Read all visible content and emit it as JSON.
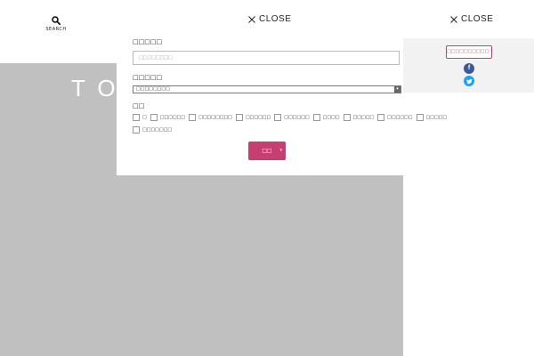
{
  "header": {
    "search_label": "SEARCH",
    "close_label_1": "CLOSE",
    "close_label_2": "CLOSE"
  },
  "hero": {
    "text": "TO"
  },
  "search_form": {
    "field1_label": "□□□□□",
    "field1_placeholder": "□□□□□□□□",
    "field2_label": "□□□□□",
    "field2_selected": "□□□□□□□□",
    "field3_label": "□□",
    "checkboxes": [
      "□",
      "□□□□□□",
      "□□□□□□□□",
      "□□□□□□",
      "□□□□□□",
      "□□□□",
      "□□□□□",
      "□□□□□□",
      "□□□□□",
      "□□□□□□□"
    ],
    "submit_label": "□□"
  },
  "share": {
    "button_label": "□□□□□□□□□□ *",
    "facebook_icon": "facebook-icon",
    "twitter_icon": "twitter-icon"
  },
  "colors": {
    "accent": "#c63e72",
    "gray_bg": "#c0c0c0",
    "facebook": "#3b5998",
    "twitter": "#1da1f2"
  }
}
